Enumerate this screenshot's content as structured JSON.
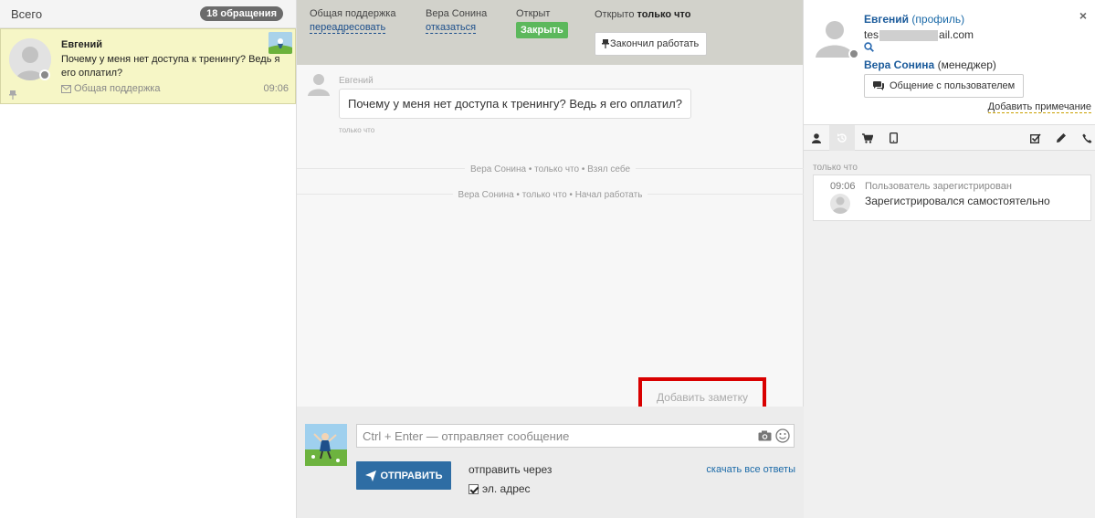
{
  "left": {
    "title": "Всего",
    "count_badge": "18 обращения",
    "ticket": {
      "name": "Евгений",
      "message": "Почему у меня нет доступа к тренингу? Ведь я его оплатил?",
      "channel": "Общая поддержка",
      "time": "09:06"
    }
  },
  "header": {
    "department_label": "Общая поддержка",
    "redirect_link": "переадресовать",
    "agent_name": "Вера Сонина",
    "decline_link": "отказаться",
    "status_label": "Открыт",
    "close_button": "Закрыть",
    "opened_prefix": "Открыто",
    "opened_when": "только что",
    "finish_button": "Закончил работать"
  },
  "chat": {
    "message_author": "Евгений",
    "message_text": "Почему у меня нет доступа к тренингу? Ведь я его оплатил?",
    "message_time": "только что",
    "events": [
      "Вера Сонина • только что • Взял себе",
      "Вера Сонина • только что • Начал работать"
    ],
    "add_note_button": "Добавить заметку"
  },
  "composer": {
    "placeholder": "Ctrl + Enter — отправляет сообщение",
    "send_button": "ОТПРАВИТЬ",
    "send_via_label": "отправить через",
    "email_checkbox_label": "эл. адрес",
    "email_checked": true,
    "download_link": "скачать все ответы"
  },
  "profile": {
    "name": "Евгений",
    "profile_link": "(профиль)",
    "email_start": "tes",
    "email_end": "ail.com",
    "manager_name": "Вера Сонина",
    "manager_role": "(менеджер)",
    "contact_button": "Общение с пользователем",
    "add_note_link": "Добавить примечание"
  },
  "tabs": [
    "user-icon",
    "history-icon",
    "cart-icon",
    "tablet-icon",
    "checklist-icon",
    "pencil-icon",
    "phone-icon"
  ],
  "activity": {
    "when": "только что",
    "time": "09:06",
    "title": "Пользователь зарегистрирован",
    "text": "Зарегистрировался самостоятельно"
  },
  "colors": {
    "accent_blue": "#2e6da4",
    "close_green": "#5cb85c",
    "highlight_red": "#d90000",
    "ticket_bg": "#f6f6c6"
  }
}
